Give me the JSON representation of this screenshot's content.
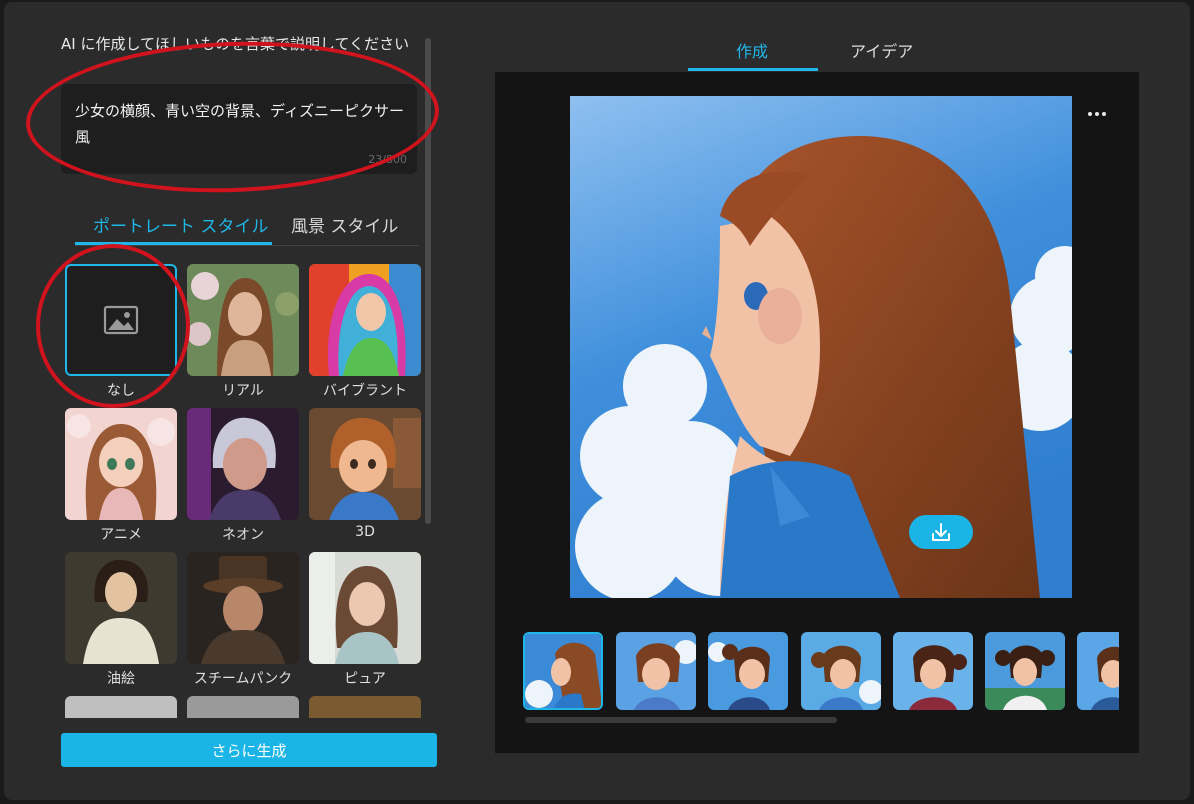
{
  "prompt": {
    "label": "AI に作成してほしいものを言葉で説明してください",
    "text": "少女の横顔、青い空の背景、ディズニーピクサー風",
    "count": "23/800"
  },
  "style_tabs": [
    {
      "label": "ポートレート スタイル",
      "active": true
    },
    {
      "label": "風景 スタイル",
      "active": false
    }
  ],
  "styles": [
    {
      "label": "なし",
      "selected": true
    },
    {
      "label": "リアル"
    },
    {
      "label": "バイブラント"
    },
    {
      "label": "アニメ"
    },
    {
      "label": "ネオン"
    },
    {
      "label": "3D"
    },
    {
      "label": "油絵"
    },
    {
      "label": "スチームパンク"
    },
    {
      "label": "ピュア"
    }
  ],
  "generate_button": "さらに生成",
  "top_tabs": [
    {
      "label": "作成",
      "active": true
    },
    {
      "label": "アイデア",
      "active": false
    }
  ],
  "colors": {
    "accent": "#1fb6e8",
    "annotation": "#d0131d",
    "panel": "#2b2b2b",
    "canvas": "#141414"
  },
  "icons": {
    "none_style": "image-placeholder-icon",
    "more": "more-horizontal-icon",
    "download": "download-icon"
  }
}
